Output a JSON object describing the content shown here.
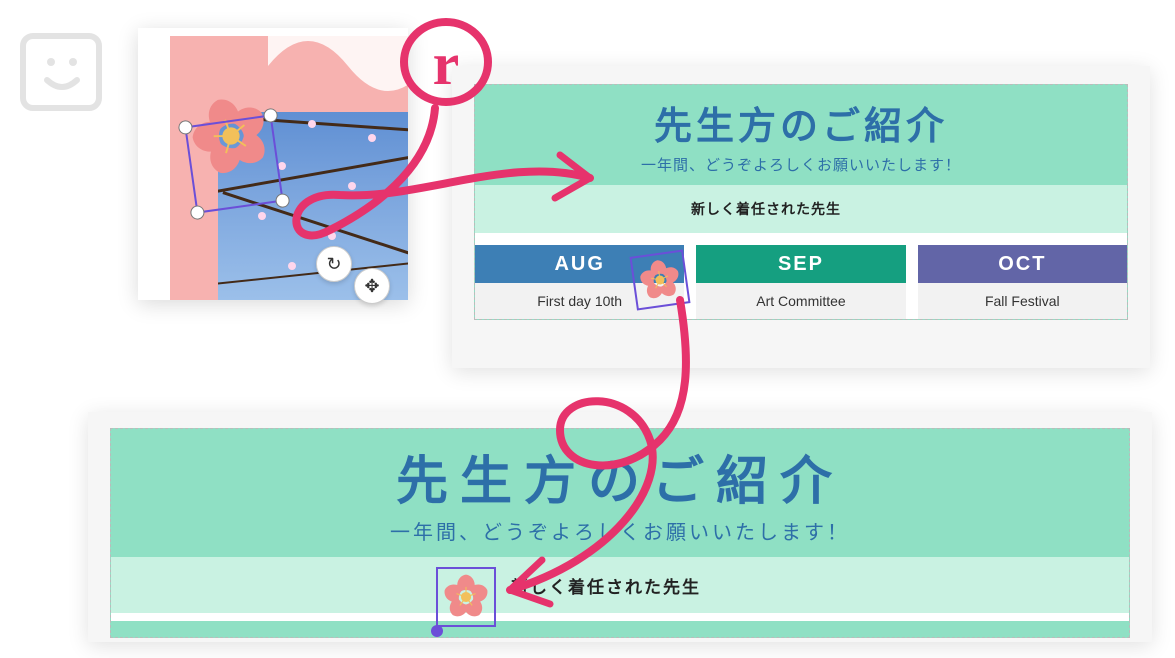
{
  "annotation": {
    "letter": "r",
    "color": "#E6336C"
  },
  "panel1": {
    "tools": {
      "rotate_glyph": "↻",
      "move_glyph": "✥"
    }
  },
  "intro": {
    "title": "先生方のご紹介",
    "subtitle": "一年間、どうぞよろしくお願いいたします！",
    "band_label": "新しく着任された先生"
  },
  "months": [
    {
      "code": "AUG",
      "event": "First day 10th",
      "color": "#3d7fb5"
    },
    {
      "code": "SEP",
      "event": "Art Committee",
      "color": "#159f80"
    },
    {
      "code": "OCT",
      "event": "Fall Festival",
      "color": "#6265a7"
    }
  ],
  "icons": {
    "sakura": "sakura-flower"
  }
}
